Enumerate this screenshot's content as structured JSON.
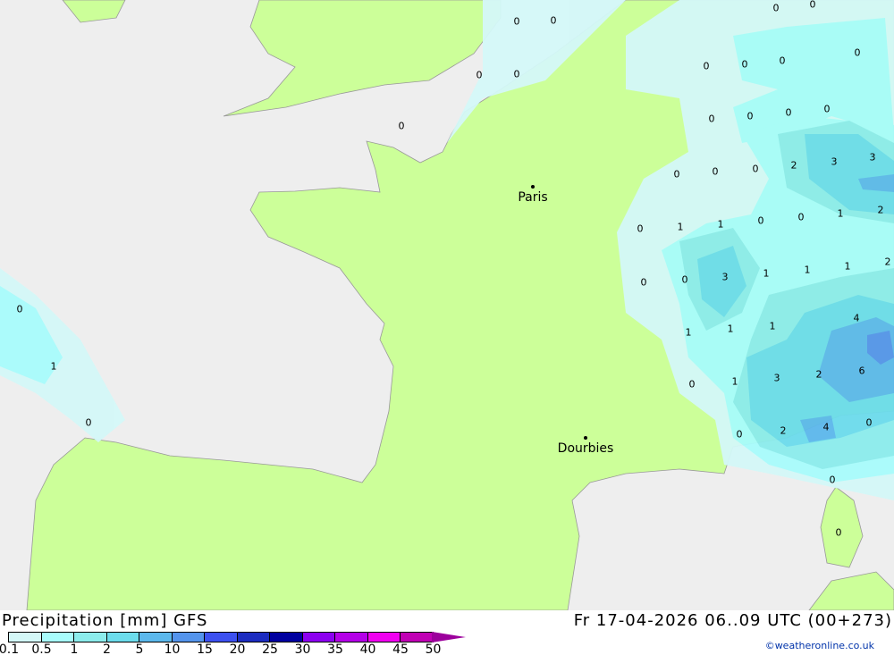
{
  "title": "Precipitation [mm] GFS",
  "datetime": "Fr 17-04-2026 06..09 UTC (00+273)",
  "credit": "©weatheronline.co.uk",
  "cities": [
    {
      "name": "Paris"
    },
    {
      "name": "Dourbies"
    }
  ],
  "legend": {
    "ticks": [
      "0.1",
      "0.5",
      "1",
      "2",
      "5",
      "10",
      "15",
      "20",
      "25",
      "30",
      "35",
      "40",
      "45",
      "50"
    ],
    "colors": [
      "#d4f8f8",
      "#a8fcfc",
      "#8cecec",
      "#6cdcec",
      "#5cb8ec",
      "#5494ec",
      "#3c50f0",
      "#1c2cc0",
      "#0000a0",
      "#8c00f0",
      "#b400e8",
      "#f000f0",
      "#c000b4"
    ],
    "arrow_color": "#9c009c"
  },
  "colors": {
    "land": "#ccff99",
    "sea": "#eeeeee"
  },
  "values": [
    "0",
    "0",
    "0",
    "0",
    "0",
    "0",
    "0",
    "0",
    "0",
    "0",
    "0",
    "0",
    "0",
    "0",
    "0",
    "0",
    "0",
    "0",
    "2",
    "3",
    "3",
    "0",
    "1",
    "1",
    "0",
    "0",
    "1",
    "2",
    "0",
    "0",
    "3",
    "1",
    "1",
    "1",
    "2",
    "0",
    "4",
    "1",
    "1",
    "1",
    "1",
    "6",
    "2",
    "3",
    "0",
    "1",
    "0",
    "0",
    "4",
    "2",
    "0",
    "0",
    "0"
  ]
}
